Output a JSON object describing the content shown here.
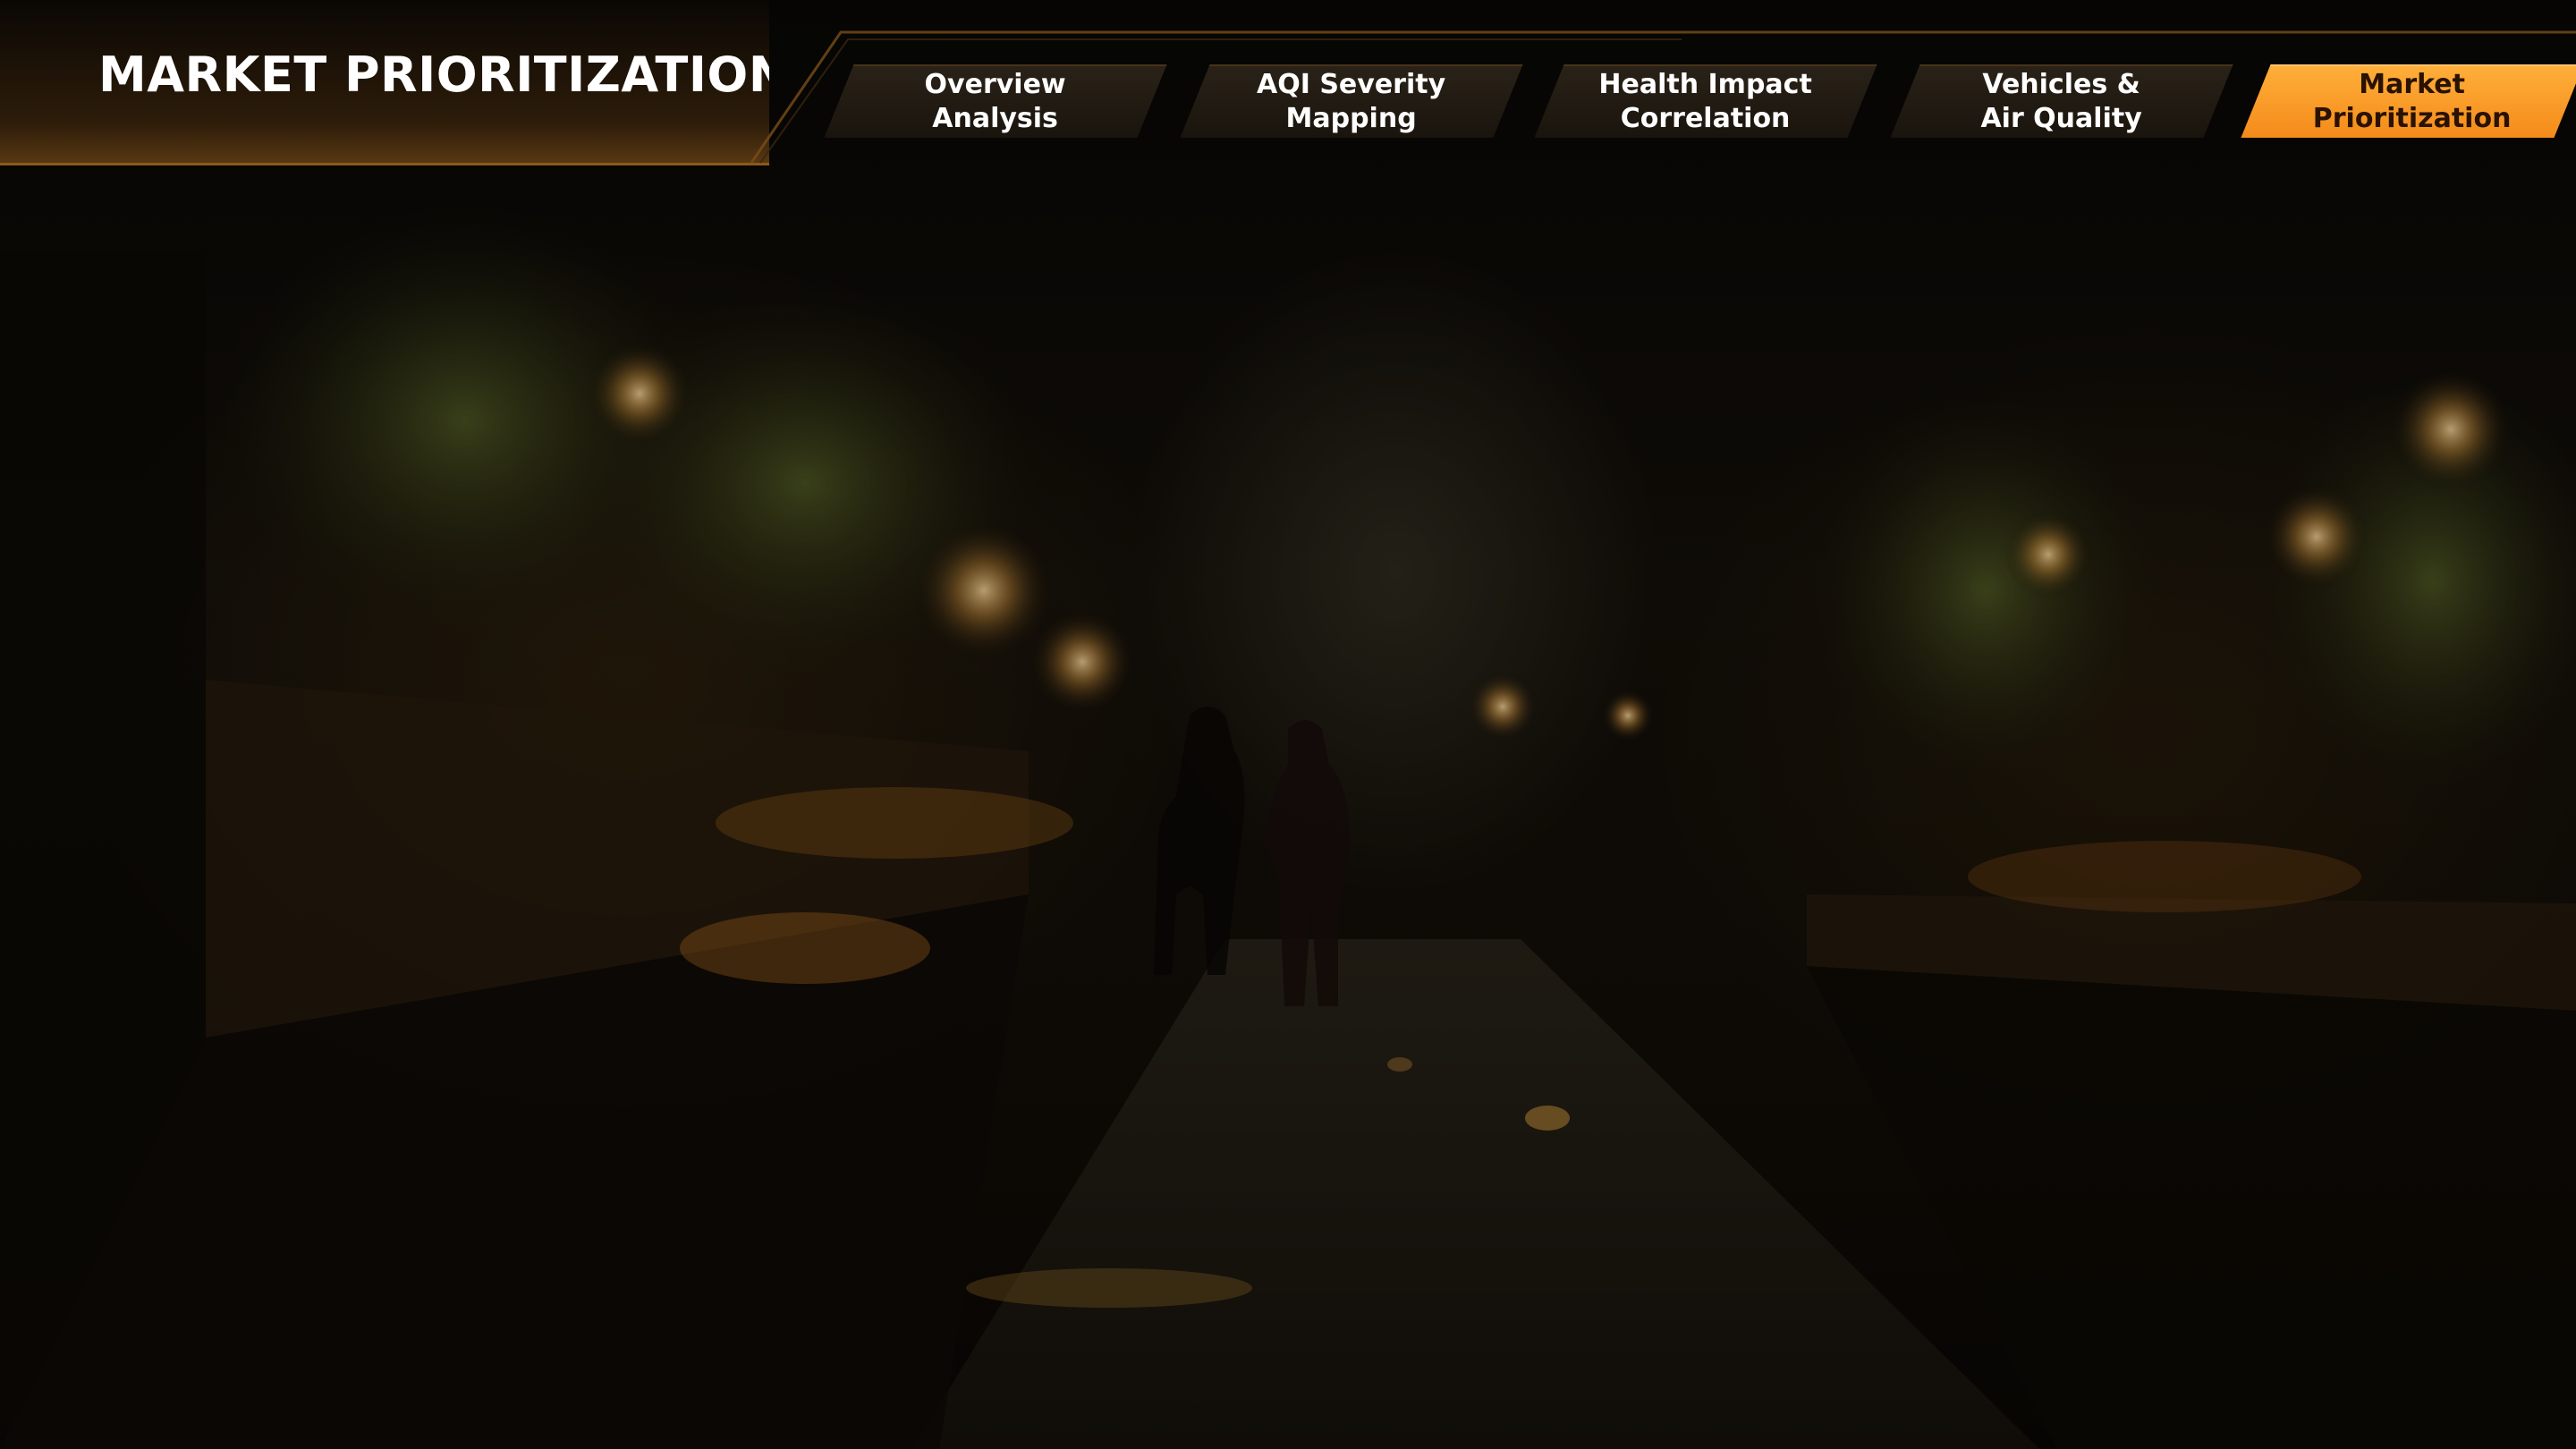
{
  "header": {
    "title": "MARKET PRIORITIZATION"
  },
  "nav": {
    "tabs": [
      {
        "label": "Overview\nAnalysis",
        "active": false
      },
      {
        "label": "AQI Severity\nMapping",
        "active": false
      },
      {
        "label": "Health Impact\nCorrelation",
        "active": false
      },
      {
        "label": "Vehicles &\nAir Quality",
        "active": false
      },
      {
        "label": "Market\nPrioritization",
        "active": true
      }
    ]
  },
  "colors": {
    "accent": "#f79a24",
    "tab_inactive": "#1d170f",
    "header_gradient_end": "#5c3a14"
  },
  "background": {
    "scene": "night-market-street-photo"
  }
}
